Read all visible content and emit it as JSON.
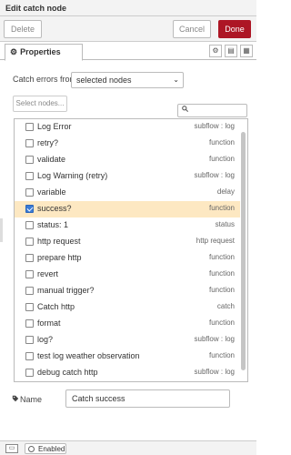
{
  "header": {
    "title": "Edit catch node"
  },
  "toolbar": {
    "delete_label": "Delete",
    "cancel_label": "Cancel",
    "done_label": "Done",
    "done_color": "#ad1625"
  },
  "tabs": {
    "properties_label": "Properties"
  },
  "form": {
    "catch_label": "Catch errors from",
    "catch_select_value": "selected nodes",
    "select_nodes_label": "Select nodes...",
    "search_placeholder": "",
    "name_label": "Name",
    "name_value": "Catch success"
  },
  "nodes": [
    {
      "label": "Log Error",
      "type": "subflow : log",
      "checked": false
    },
    {
      "label": "retry?",
      "type": "function",
      "checked": false
    },
    {
      "label": "validate",
      "type": "function",
      "checked": false
    },
    {
      "label": "Log Warning (retry)",
      "type": "subflow : log",
      "checked": false
    },
    {
      "label": "variable",
      "type": "delay",
      "checked": false
    },
    {
      "label": "success?",
      "type": "function",
      "checked": true
    },
    {
      "label": "status: 1",
      "type": "status",
      "checked": false
    },
    {
      "label": "http request",
      "type": "http request",
      "checked": false
    },
    {
      "label": "prepare http",
      "type": "function",
      "checked": false
    },
    {
      "label": "revert",
      "type": "function",
      "checked": false
    },
    {
      "label": "manual trigger?",
      "type": "function",
      "checked": false
    },
    {
      "label": "Catch http",
      "type": "catch",
      "checked": false
    },
    {
      "label": "format",
      "type": "function",
      "checked": false
    },
    {
      "label": "log?",
      "type": "subflow : log",
      "checked": false
    },
    {
      "label": "test log weather observation",
      "type": "function",
      "checked": false
    },
    {
      "label": "debug catch http",
      "type": "subflow : log",
      "checked": false
    }
  ],
  "footer": {
    "enabled_label": "Enabled"
  },
  "icons": {
    "properties": "gear-icon",
    "settings_tab": "gear-icon",
    "description_tab": "document-icon",
    "appearance_tab": "layout-icon",
    "search": "search-icon",
    "name": "tag-icon",
    "book": "book-icon",
    "toggle": "circle-icon"
  },
  "colors": {
    "selected_row": "#fde8c2",
    "checkbox_checked": "#3a7bd5"
  }
}
